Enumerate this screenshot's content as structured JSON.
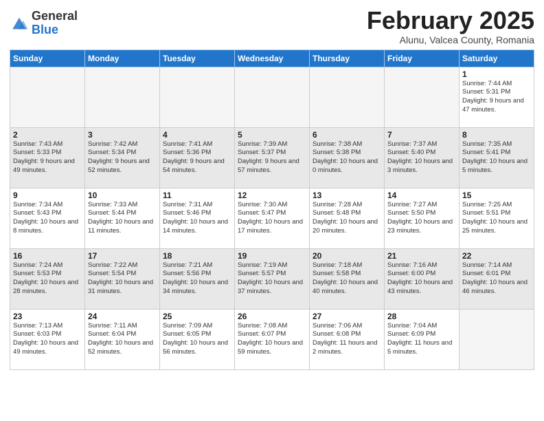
{
  "header": {
    "logo_general": "General",
    "logo_blue": "Blue",
    "month_title": "February 2025",
    "subtitle": "Alunu, Valcea County, Romania"
  },
  "calendar": {
    "days_of_week": [
      "Sunday",
      "Monday",
      "Tuesday",
      "Wednesday",
      "Thursday",
      "Friday",
      "Saturday"
    ],
    "weeks": [
      [
        {
          "num": "",
          "info": ""
        },
        {
          "num": "",
          "info": ""
        },
        {
          "num": "",
          "info": ""
        },
        {
          "num": "",
          "info": ""
        },
        {
          "num": "",
          "info": ""
        },
        {
          "num": "",
          "info": ""
        },
        {
          "num": "1",
          "info": "Sunrise: 7:44 AM\nSunset: 5:31 PM\nDaylight: 9 hours and 47 minutes."
        }
      ],
      [
        {
          "num": "2",
          "info": "Sunrise: 7:43 AM\nSunset: 5:33 PM\nDaylight: 9 hours and 49 minutes."
        },
        {
          "num": "3",
          "info": "Sunrise: 7:42 AM\nSunset: 5:34 PM\nDaylight: 9 hours and 52 minutes."
        },
        {
          "num": "4",
          "info": "Sunrise: 7:41 AM\nSunset: 5:36 PM\nDaylight: 9 hours and 54 minutes."
        },
        {
          "num": "5",
          "info": "Sunrise: 7:39 AM\nSunset: 5:37 PM\nDaylight: 9 hours and 57 minutes."
        },
        {
          "num": "6",
          "info": "Sunrise: 7:38 AM\nSunset: 5:38 PM\nDaylight: 10 hours and 0 minutes."
        },
        {
          "num": "7",
          "info": "Sunrise: 7:37 AM\nSunset: 5:40 PM\nDaylight: 10 hours and 3 minutes."
        },
        {
          "num": "8",
          "info": "Sunrise: 7:35 AM\nSunset: 5:41 PM\nDaylight: 10 hours and 5 minutes."
        }
      ],
      [
        {
          "num": "9",
          "info": "Sunrise: 7:34 AM\nSunset: 5:43 PM\nDaylight: 10 hours and 8 minutes."
        },
        {
          "num": "10",
          "info": "Sunrise: 7:33 AM\nSunset: 5:44 PM\nDaylight: 10 hours and 11 minutes."
        },
        {
          "num": "11",
          "info": "Sunrise: 7:31 AM\nSunset: 5:46 PM\nDaylight: 10 hours and 14 minutes."
        },
        {
          "num": "12",
          "info": "Sunrise: 7:30 AM\nSunset: 5:47 PM\nDaylight: 10 hours and 17 minutes."
        },
        {
          "num": "13",
          "info": "Sunrise: 7:28 AM\nSunset: 5:48 PM\nDaylight: 10 hours and 20 minutes."
        },
        {
          "num": "14",
          "info": "Sunrise: 7:27 AM\nSunset: 5:50 PM\nDaylight: 10 hours and 23 minutes."
        },
        {
          "num": "15",
          "info": "Sunrise: 7:25 AM\nSunset: 5:51 PM\nDaylight: 10 hours and 25 minutes."
        }
      ],
      [
        {
          "num": "16",
          "info": "Sunrise: 7:24 AM\nSunset: 5:53 PM\nDaylight: 10 hours and 28 minutes."
        },
        {
          "num": "17",
          "info": "Sunrise: 7:22 AM\nSunset: 5:54 PM\nDaylight: 10 hours and 31 minutes."
        },
        {
          "num": "18",
          "info": "Sunrise: 7:21 AM\nSunset: 5:56 PM\nDaylight: 10 hours and 34 minutes."
        },
        {
          "num": "19",
          "info": "Sunrise: 7:19 AM\nSunset: 5:57 PM\nDaylight: 10 hours and 37 minutes."
        },
        {
          "num": "20",
          "info": "Sunrise: 7:18 AM\nSunset: 5:58 PM\nDaylight: 10 hours and 40 minutes."
        },
        {
          "num": "21",
          "info": "Sunrise: 7:16 AM\nSunset: 6:00 PM\nDaylight: 10 hours and 43 minutes."
        },
        {
          "num": "22",
          "info": "Sunrise: 7:14 AM\nSunset: 6:01 PM\nDaylight: 10 hours and 46 minutes."
        }
      ],
      [
        {
          "num": "23",
          "info": "Sunrise: 7:13 AM\nSunset: 6:03 PM\nDaylight: 10 hours and 49 minutes."
        },
        {
          "num": "24",
          "info": "Sunrise: 7:11 AM\nSunset: 6:04 PM\nDaylight: 10 hours and 52 minutes."
        },
        {
          "num": "25",
          "info": "Sunrise: 7:09 AM\nSunset: 6:05 PM\nDaylight: 10 hours and 56 minutes."
        },
        {
          "num": "26",
          "info": "Sunrise: 7:08 AM\nSunset: 6:07 PM\nDaylight: 10 hours and 59 minutes."
        },
        {
          "num": "27",
          "info": "Sunrise: 7:06 AM\nSunset: 6:08 PM\nDaylight: 11 hours and 2 minutes."
        },
        {
          "num": "28",
          "info": "Sunrise: 7:04 AM\nSunset: 6:09 PM\nDaylight: 11 hours and 5 minutes."
        },
        {
          "num": "",
          "info": ""
        }
      ]
    ]
  }
}
